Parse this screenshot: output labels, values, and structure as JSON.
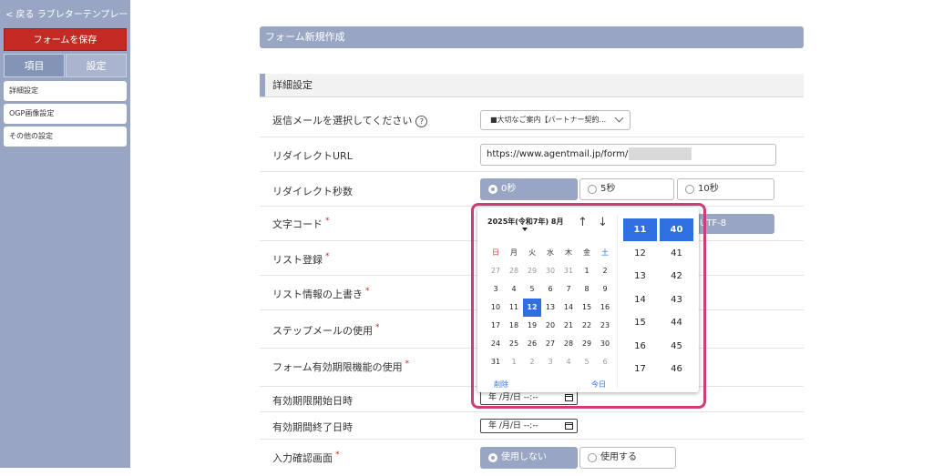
{
  "sidebar": {
    "back_label": "< 戻る ラブレターテンプレート",
    "save_label": "フォームを保存",
    "tabs": [
      {
        "label": "項目"
      },
      {
        "label": "設定"
      }
    ],
    "items": [
      {
        "label": "詳細設定"
      },
      {
        "label": "OGP画像設定"
      },
      {
        "label": "その他の設定"
      }
    ]
  },
  "header": {
    "title": "フォーム新規作成"
  },
  "section": {
    "title": "詳細設定"
  },
  "rows": {
    "reply_mail": {
      "label": "返信メールを選択してください",
      "help": "?",
      "value": "■大切なご案内【パートナー契約..."
    },
    "redirect_url": {
      "label": "リダイレクトURL",
      "value": "https://www.agentmail.jp/form/ht/6"
    },
    "redirect_seconds": {
      "label": "リダイレクト秒数",
      "options": [
        "0秒",
        "5秒",
        "10秒"
      ],
      "selected": "0秒"
    },
    "charset": {
      "label": "文字コード",
      "required": "*",
      "value": "UTF-8"
    },
    "list_register": {
      "label": "リスト登録",
      "required": "*"
    },
    "list_overwrite": {
      "label": "リスト情報の上書き",
      "required": "*"
    },
    "step_mail": {
      "label": "ステップメールの使用",
      "required": "*"
    },
    "expiry_function": {
      "label": "フォーム有効期限機能の使用",
      "required": "*"
    },
    "expiry_start": {
      "label": "有効期限開始日時",
      "value": "年 /月/日 --:--"
    },
    "expiry_end": {
      "label": "有効期間終了日時",
      "value": "年 /月/日 --:--"
    },
    "confirm_screen": {
      "label": "入力確認画面",
      "required": "*",
      "options": [
        "使用しない",
        "使用する"
      ],
      "selected": "使用しない"
    }
  },
  "picker": {
    "month_title": "2025年(令和7年) 8月",
    "up_arrow": "↑",
    "down_arrow": "↓",
    "weekdays": [
      "日",
      "月",
      "火",
      "水",
      "木",
      "金",
      "土"
    ],
    "weeks": [
      [
        "27",
        "28",
        "29",
        "30",
        "31",
        "1",
        "2"
      ],
      [
        "3",
        "4",
        "5",
        "6",
        "7",
        "8",
        "9"
      ],
      [
        "10",
        "11",
        "12",
        "13",
        "14",
        "15",
        "16"
      ],
      [
        "17",
        "18",
        "19",
        "20",
        "21",
        "22",
        "23"
      ],
      [
        "24",
        "25",
        "26",
        "27",
        "28",
        "29",
        "30"
      ],
      [
        "31",
        "1",
        "2",
        "3",
        "4",
        "5",
        "6"
      ]
    ],
    "selected_day": "12",
    "clear_label": "削除",
    "today_label": "今日",
    "hours": [
      "11",
      "12",
      "13",
      "14",
      "15",
      "16",
      "17"
    ],
    "minutes": [
      "40",
      "41",
      "42",
      "43",
      "44",
      "45",
      "46"
    ],
    "selected_hour": "11",
    "selected_minute": "40",
    "colors": {
      "accent": "#2f6fe0",
      "sunday": "#d9342b",
      "saturday": "#2f6fe0",
      "highlight_outline": "#d03c78"
    }
  }
}
